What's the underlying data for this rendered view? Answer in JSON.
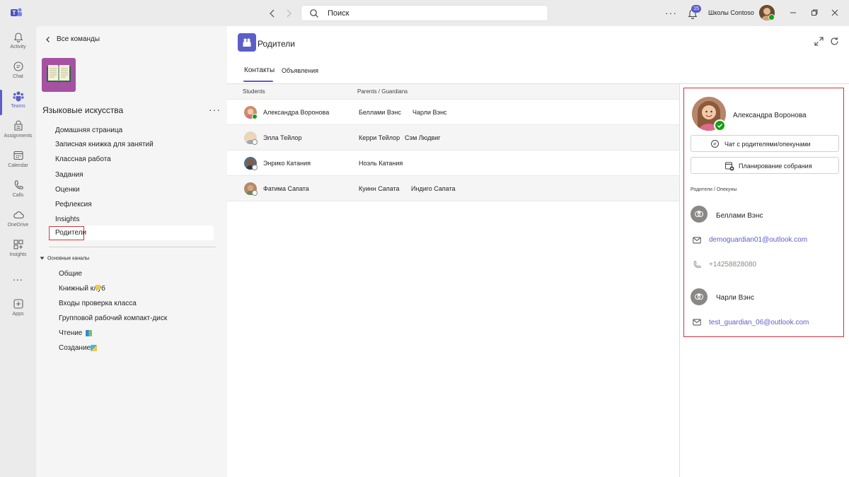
{
  "titlebar": {
    "search_placeholder": "Поиск",
    "notifications_count": "15",
    "org_name": "Школы Contoso"
  },
  "rail": {
    "items": [
      {
        "label": "Activity",
        "icon": "bell-icon"
      },
      {
        "label": "Chat",
        "icon": "chat-icon"
      },
      {
        "label": "Teams",
        "icon": "teams-icon",
        "active": true
      },
      {
        "label": "Assignments",
        "icon": "assignments-icon"
      },
      {
        "label": "Calendar",
        "icon": "calendar-icon"
      },
      {
        "label": "Calls",
        "icon": "phone-icon"
      },
      {
        "label": "OneDrive",
        "icon": "cloud-icon"
      },
      {
        "label": "Insights",
        "icon": "insights-icon"
      },
      {
        "label": "...",
        "icon": "more-icon"
      },
      {
        "label": "Apps",
        "icon": "apps-icon"
      }
    ]
  },
  "team": {
    "back_label": "Все команды",
    "name": "Языковые искусства",
    "tabs": [
      "Домашняя страница",
      "Записная книжка для занятий",
      "Классная работа",
      "Задания",
      "Оценки",
      "Рефлексия",
      "Insights",
      "Родители"
    ],
    "selected_tab": "Родители",
    "channels_header": "Основные каналы",
    "channels": [
      "Общие",
      "Книжный клуб",
      "Входы проверка класса",
      "Групповой рабочий компакт-диск",
      "Чтение",
      "Создание"
    ]
  },
  "main": {
    "title": "Родители",
    "tabs": [
      "Контакты",
      "Объявления"
    ],
    "active_tab": "Контакты",
    "columns": {
      "students": "Students",
      "parents": "Parents / Guardians"
    },
    "rows": [
      {
        "student": "Александра Воронова",
        "parents": [
          "Беллами Вэнс",
          "Чарли Вэнс"
        ]
      },
      {
        "student": "Элла Тейлор",
        "parents": [
          "Керри Тейлор",
          "Сэм Людвиг"
        ]
      },
      {
        "student": "Энрико Катания",
        "parents": [
          "Ноэль Катания"
        ]
      },
      {
        "student": "Фатима Сапата",
        "parents": [
          "Куинн Сапата",
          "Индиго Сапата"
        ]
      }
    ]
  },
  "detail": {
    "student_name": "Александра Воронова",
    "chat_button": "Чат с родителями/опекунами",
    "schedule_button": "Планирование собрания",
    "section_label": "Родители / Опекуны",
    "guardians": [
      {
        "name": "Беллами Вэнс",
        "email": "demoguardian01@outlook.com",
        "phone": "+14258828080"
      },
      {
        "name": "Чарли Вэнс",
        "email": "test_guardian_06@outlook.com"
      }
    ]
  },
  "colors": {
    "accent": "#5b5fc7",
    "highlight_border": "#d13438",
    "team_avatar": "#a651a2",
    "presence_available": "#13a10e"
  }
}
